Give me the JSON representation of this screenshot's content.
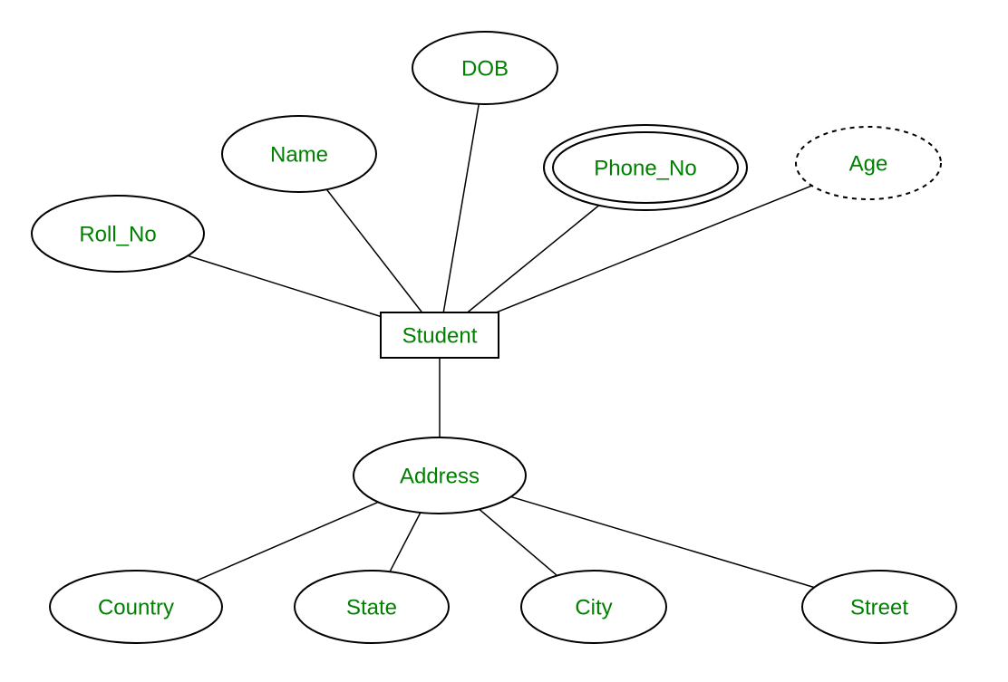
{
  "entity": {
    "label": "Student"
  },
  "attributes": {
    "roll_no": {
      "label": "Roll_No"
    },
    "name": {
      "label": "Name"
    },
    "dob": {
      "label": "DOB"
    },
    "phone_no": {
      "label": "Phone_No"
    },
    "age": {
      "label": "Age"
    },
    "address": {
      "label": "Address"
    },
    "country": {
      "label": "Country"
    },
    "state": {
      "label": "State"
    },
    "city": {
      "label": "City"
    },
    "street": {
      "label": "Street"
    }
  }
}
